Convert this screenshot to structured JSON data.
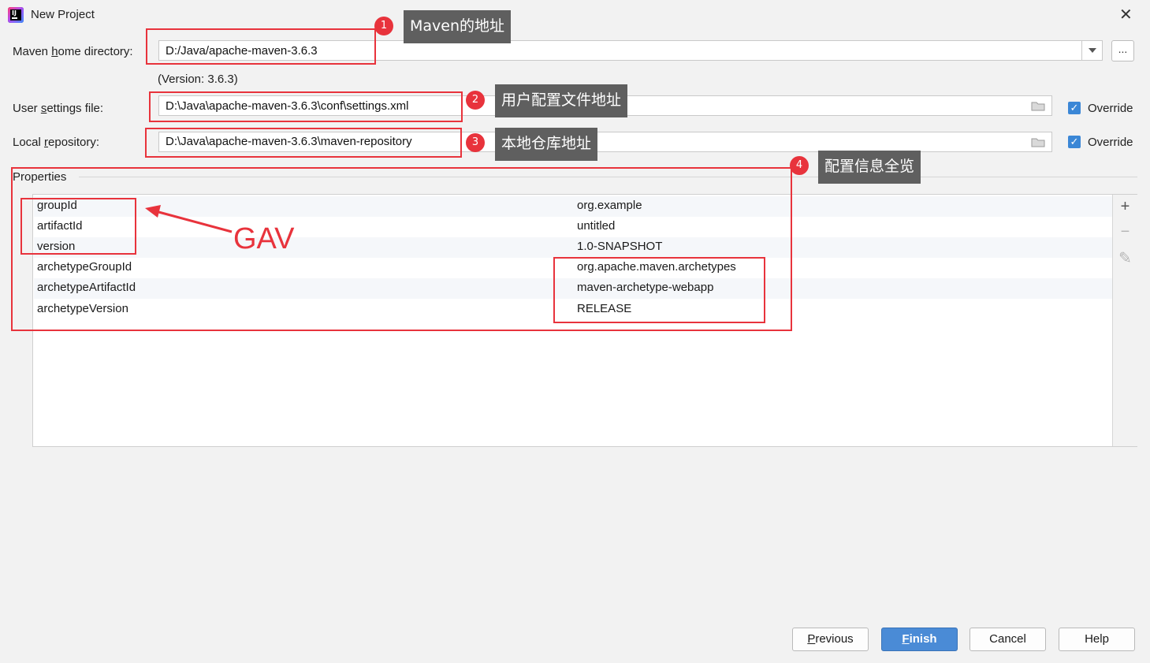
{
  "window": {
    "title": "New Project",
    "close": "✕"
  },
  "maven_home": {
    "label_pre": "Maven ",
    "label_mnemonic": "h",
    "label_post": "ome directory:",
    "value": "D:/Java/apache-maven-3.6.3",
    "version_text": "(Version: 3.6.3)",
    "browse_label": "..."
  },
  "user_settings": {
    "label_pre": "User ",
    "label_mnemonic": "s",
    "label_post": "ettings file:",
    "value": "D:\\Java\\apache-maven-3.6.3\\conf\\settings.xml",
    "override_label": "Override",
    "override_checked": true
  },
  "local_repo": {
    "label_pre": "Local ",
    "label_mnemonic": "r",
    "label_post": "epository:",
    "value": "D:\\Java\\apache-maven-3.6.3\\maven-repository",
    "override_label": "Override",
    "override_checked": true
  },
  "properties": {
    "title": "Properties",
    "rows": [
      {
        "key": "groupId",
        "value": "org.example"
      },
      {
        "key": "artifactId",
        "value": "untitled"
      },
      {
        "key": "version",
        "value": "1.0-SNAPSHOT"
      },
      {
        "key": "archetypeGroupId",
        "value": "org.apache.maven.archetypes"
      },
      {
        "key": "archetypeArtifactId",
        "value": "maven-archetype-webapp"
      },
      {
        "key": "archetypeVersion",
        "value": "RELEASE"
      }
    ],
    "add_icon": "+",
    "remove_icon": "−",
    "edit_icon": "✎"
  },
  "annotations": {
    "badges": [
      "1",
      "2",
      "3",
      "4"
    ],
    "tips": [
      "Maven的地址",
      "用户配置文件地址",
      "本地仓库地址",
      "配置信息全览"
    ],
    "gav": "GAV",
    "accent_color": "#e8333c"
  },
  "buttons": {
    "previous_mnemonic": "P",
    "previous_rest": "revious",
    "finish_mnemonic": "F",
    "finish_rest": "inish",
    "cancel": "Cancel",
    "help": "Help"
  },
  "icons": {
    "app": "intellij-icon",
    "folder": "folder-icon",
    "dropdown": "chevron-down-icon",
    "checkbox": "checkbox-checked-icon"
  }
}
